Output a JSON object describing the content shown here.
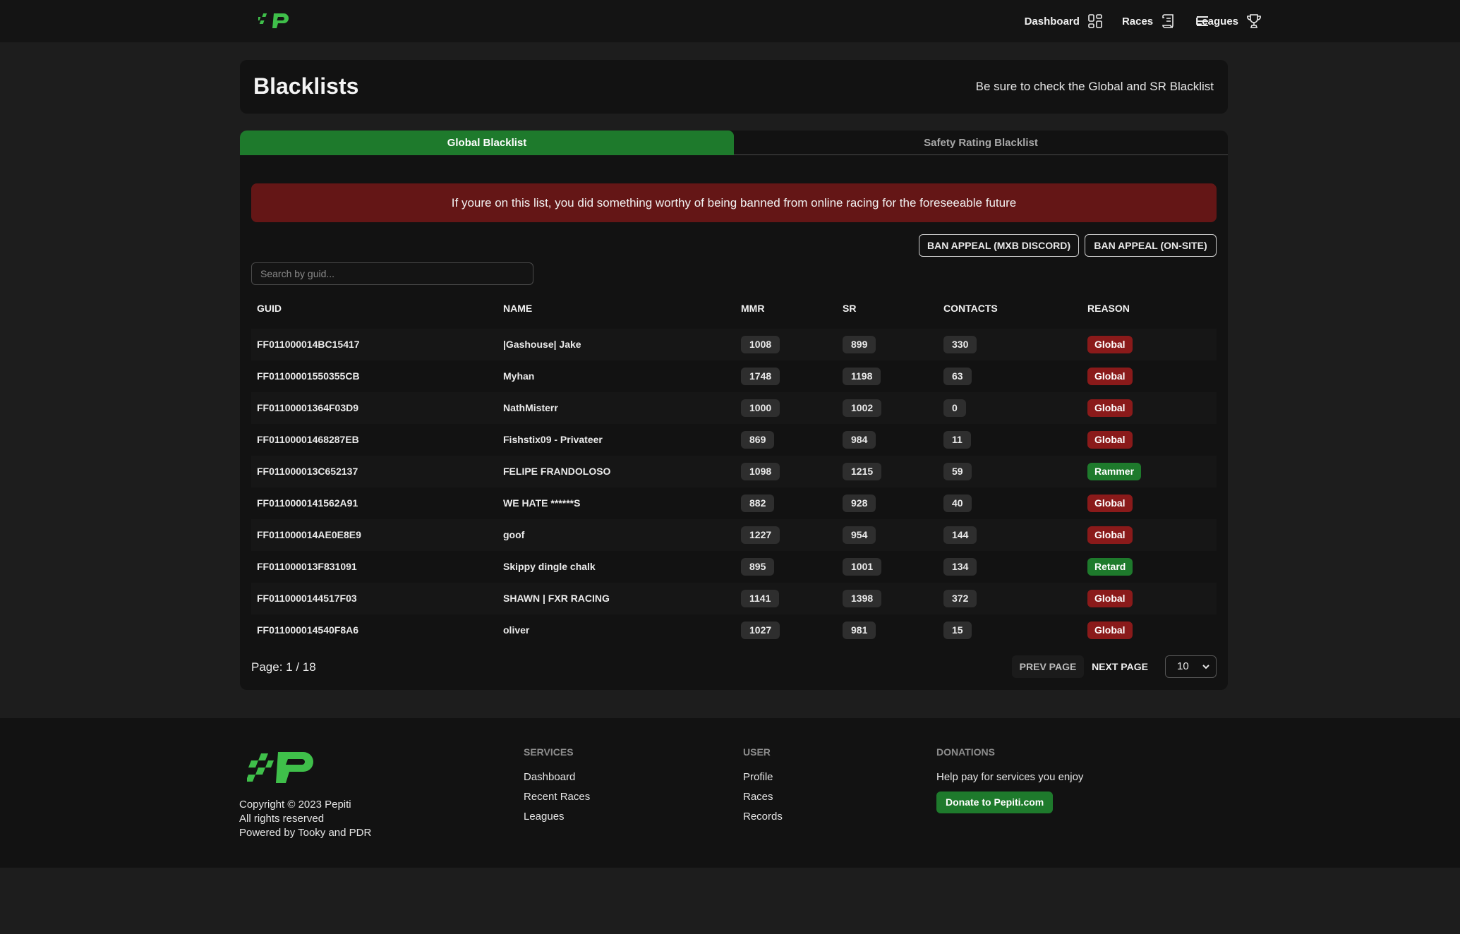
{
  "nav": {
    "links": [
      {
        "label": "Dashboard",
        "icon": "dashboard-grid-icon"
      },
      {
        "label": "Races",
        "icon": "scroll-icon"
      },
      {
        "label": "Leagues",
        "icon": "trophy-icon"
      }
    ],
    "menu_icon": "hamburger-menu-icon"
  },
  "header": {
    "title": "Blacklists",
    "note": "Be sure to check the Global and SR Blacklist"
  },
  "tabs": [
    {
      "label": "Global Blacklist",
      "active": true
    },
    {
      "label": "Safety Rating Blacklist",
      "active": false
    }
  ],
  "alert": {
    "text": "If youre on this list, you did something worthy of being banned from online racing for the foreseeable future"
  },
  "buttons": {
    "appeal_discord": "BAN APPEAL (MXB DISCORD)",
    "appeal_site": "BAN APPEAL (ON-SITE)"
  },
  "search": {
    "placeholder": "Search by guid...",
    "value": ""
  },
  "table": {
    "columns": [
      "GUID",
      "NAME",
      "MMR",
      "SR",
      "CONTACTS",
      "REASON"
    ],
    "rows": [
      {
        "guid": "FF011000014BC15417",
        "name": "|Gashouse| Jake",
        "mmr": "1008",
        "sr": "899",
        "contacts": "330",
        "reason": "Global"
      },
      {
        "guid": "FF01100001550355CB",
        "name": "Myhan",
        "mmr": "1748",
        "sr": "1198",
        "contacts": "63",
        "reason": "Global"
      },
      {
        "guid": "FF01100001364F03D9",
        "name": "NathMisterr",
        "mmr": "1000",
        "sr": "1002",
        "contacts": "0",
        "reason": "Global"
      },
      {
        "guid": "FF01100001468287EB",
        "name": "Fishstix09 - Privateer",
        "mmr": "869",
        "sr": "984",
        "contacts": "11",
        "reason": "Global"
      },
      {
        "guid": "FF011000013C652137",
        "name": "FELIPE FRANDOLOSO",
        "mmr": "1098",
        "sr": "1215",
        "contacts": "59",
        "reason": "Rammer"
      },
      {
        "guid": "FF0110000141562A91",
        "name": "WE HATE ******S",
        "mmr": "882",
        "sr": "928",
        "contacts": "40",
        "reason": "Global"
      },
      {
        "guid": "FF011000014AE0E8E9",
        "name": "goof",
        "mmr": "1227",
        "sr": "954",
        "contacts": "144",
        "reason": "Global"
      },
      {
        "guid": "FF011000013F831091",
        "name": "Skippy dingle chalk",
        "mmr": "895",
        "sr": "1001",
        "contacts": "134",
        "reason": "Retard"
      },
      {
        "guid": "FF0110000144517F03",
        "name": "SHAWN | FXR RACING",
        "mmr": "1141",
        "sr": "1398",
        "contacts": "372",
        "reason": "Global"
      },
      {
        "guid": "FF011000014540F8A6",
        "name": "oliver",
        "mmr": "1027",
        "sr": "981",
        "contacts": "15",
        "reason": "Global"
      }
    ]
  },
  "pagination": {
    "indicator": "Page: 1 / 18",
    "prev": "PREV PAGE",
    "next": "NEXT PAGE",
    "page_size": "10"
  },
  "footer": {
    "copyright": "Copyright © 2023 Pepiti",
    "rights": "All rights reserved",
    "powered": "Powered by Tooky and PDR",
    "services": {
      "heading": "SERVICES",
      "links": [
        "Dashboard",
        "Recent Races",
        "Leagues"
      ]
    },
    "user": {
      "heading": "USER",
      "links": [
        "Profile",
        "Races",
        "Records"
      ]
    },
    "donations": {
      "heading": "DONATIONS",
      "text": "Help pay for services you enjoy",
      "button": "Donate to Pepiti.com"
    }
  },
  "colors": {
    "accent_green": "#1e7a2c",
    "alert_red": "#641616",
    "badge_red": "#8a1a1a",
    "logo_green": "#3fbf4a"
  }
}
